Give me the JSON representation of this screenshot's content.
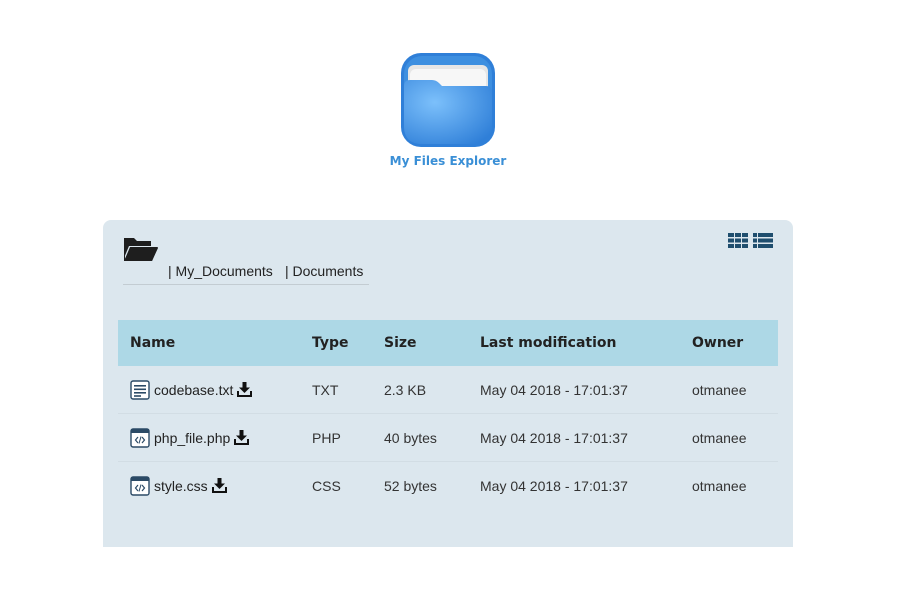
{
  "app": {
    "title": "My Files Explorer",
    "logo_icon": "folder-app-icon",
    "logo_colors": {
      "folder": "#3d8fe0",
      "folder_light": "#6fb3f5",
      "paper": "#f4f4f4"
    }
  },
  "breadcrumb": {
    "icon": "folder-open-icon",
    "items": [
      {
        "label": "| My_Documents"
      },
      {
        "label": "| Documents"
      }
    ]
  },
  "view_toggles": {
    "grid": "grid-view-icon",
    "list": "list-view-icon"
  },
  "table": {
    "columns": [
      "Name",
      "Type",
      "Size",
      "Last modification",
      "Owner"
    ],
    "header_color": "#add8e6",
    "panel_color": "#dce7ee",
    "rows": [
      {
        "icon": "text-file-icon",
        "name": "codebase.txt",
        "type": "TXT",
        "size": "2.3 KB",
        "modified": "May 04 2018 - 17:01:37",
        "owner": "otmanee"
      },
      {
        "icon": "code-file-icon",
        "name": "php_file.php",
        "type": "PHP",
        "size": "40 bytes",
        "modified": "May 04 2018 - 17:01:37",
        "owner": "otmanee"
      },
      {
        "icon": "code-file-icon",
        "name": "style.css",
        "type": "CSS",
        "size": "52 bytes",
        "modified": "May 04 2018 - 17:01:37",
        "owner": "otmanee"
      }
    ]
  }
}
